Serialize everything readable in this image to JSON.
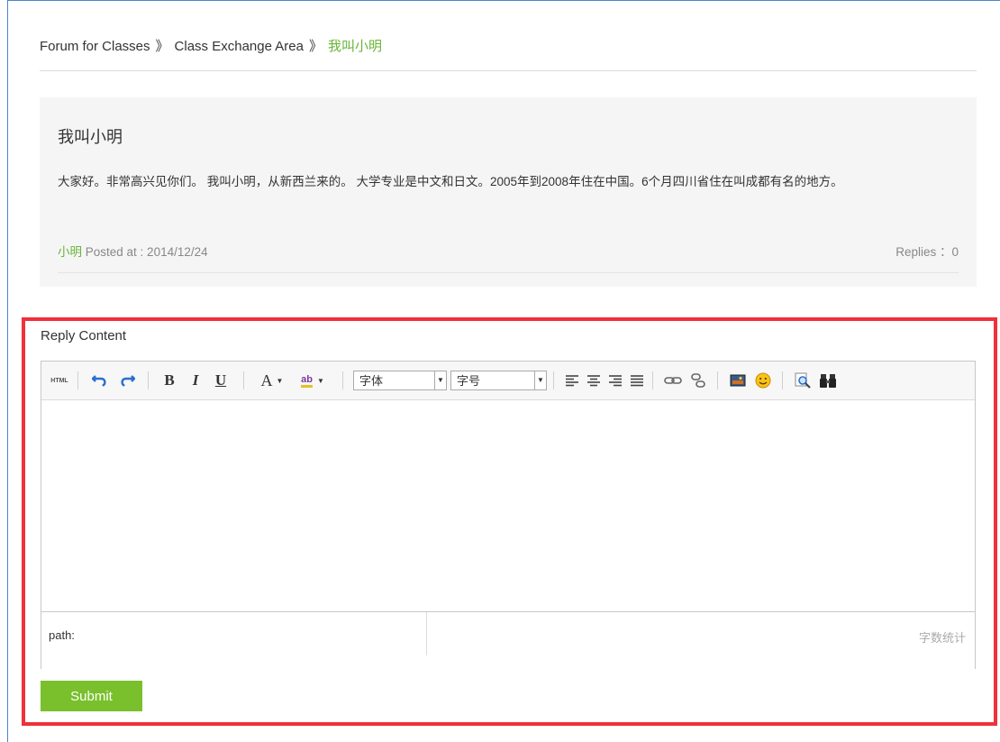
{
  "breadcrumb": {
    "items": [
      "Forum for Classes",
      "Class Exchange Area",
      "我叫小明"
    ],
    "separator": "》"
  },
  "post": {
    "title": "我叫小明",
    "body": "大家好。非常高兴见你们。 我叫小明，从新西兰来的。 大学专业是中文和日文。2005年到2008年住在中国。6个月四川省住在叫成都有名的地方。",
    "author": "小明",
    "posted_label": "Posted at : 2014/12/24",
    "replies_label": "Replies ：0"
  },
  "reply": {
    "label": "Reply Content",
    "toolbar": {
      "html_label": "HTML",
      "bold": "B",
      "italic": "I",
      "underline": "U",
      "font_color": "A",
      "highlight": "ab",
      "font_family": "字体",
      "font_size": "字号",
      "icons": [
        "html-icon",
        "undo-icon",
        "redo-icon",
        "bold-icon",
        "italic-icon",
        "underline-icon",
        "font-color-icon",
        "highlight-icon",
        "align-left-icon",
        "align-center-icon",
        "align-right-icon",
        "justify-icon",
        "link-icon",
        "unlink-icon",
        "image-icon",
        "emoticon-icon",
        "preview-icon",
        "find-icon"
      ]
    },
    "status": {
      "path_label": "path:",
      "word_count_label": "字数统计"
    },
    "submit_label": "Submit"
  },
  "colors": {
    "accent_green": "#79c02c",
    "link_green": "#6ab43a",
    "highlight_red": "#f0303a",
    "frame_blue": "#4a86c8"
  }
}
